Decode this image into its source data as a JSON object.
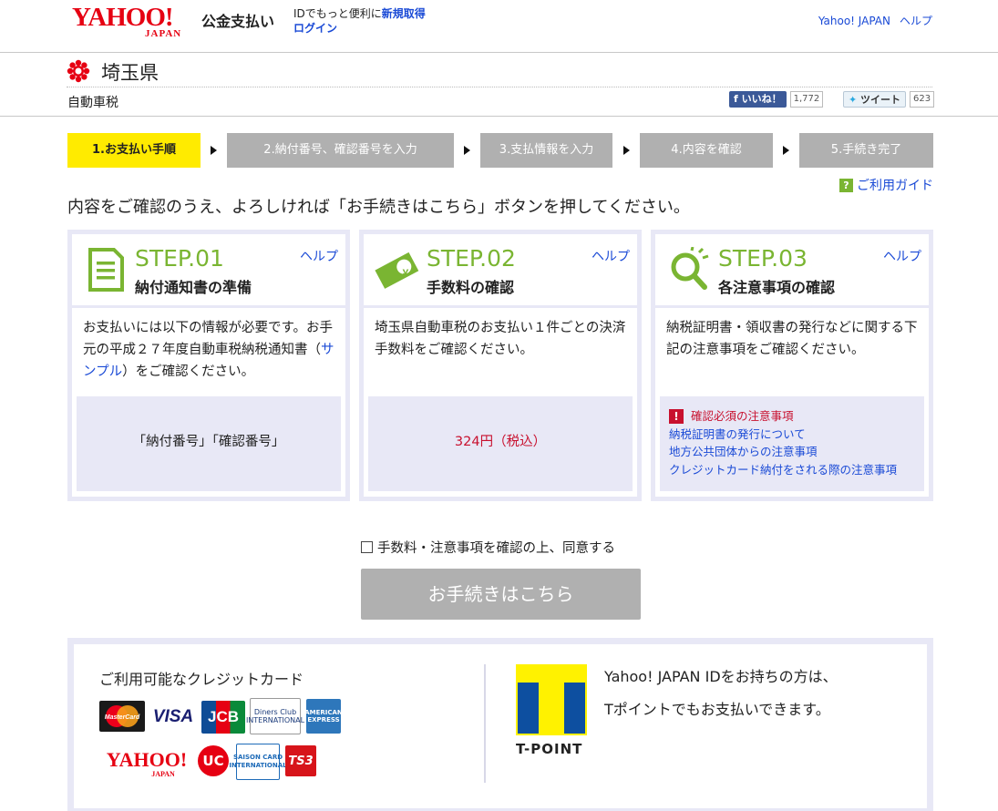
{
  "header": {
    "logo_text": "YAHOO!",
    "logo_sub": "JAPAN",
    "service_name": "公金支払い",
    "id_note": "IDでもっと便利に",
    "register_link": "新規取得",
    "login_link": "ログイン",
    "yahoo_japan_link": "Yahoo! JAPAN",
    "help_link": "ヘルプ"
  },
  "prefecture": {
    "name": "埼玉県",
    "tax_type": "自動車税"
  },
  "social": {
    "like_label": "いいね！",
    "like_count": "1,772",
    "tweet_label": "ツイート",
    "tweet_count": "623"
  },
  "steps": [
    {
      "label": "1.お支払い手順"
    },
    {
      "label": "2.納付番号、確認番号を入力"
    },
    {
      "label": "3.支払情報を入力"
    },
    {
      "label": "4.内容を確認"
    },
    {
      "label": "5.手続き完了"
    }
  ],
  "guide_link": "ご利用ガイド",
  "lead_text": "内容をご確認のうえ、よろしければ「お手続きはこちら」ボタンを押してください。",
  "panels": [
    {
      "step": "STEP.01",
      "title": "納付通知書の準備",
      "help": "ヘルプ",
      "text_before": "お支払いには以下の情報が必要です。お手元の平成２７年度自動車税納税通知書（",
      "sample_link": "サンプル",
      "text_after": "）をご確認ください。",
      "box": "「納付番号」「確認番号」"
    },
    {
      "step": "STEP.02",
      "title": "手数料の確認",
      "help": "ヘルプ",
      "text": "埼玉県自動車税のお支払い１件ごとの決済手数料をご確認ください。",
      "fee": "324円（税込）"
    },
    {
      "step": "STEP.03",
      "title": "各注意事項の確認",
      "help": "ヘルプ",
      "text": "納税証明書・領収書の発行などに関する下記の注意事項をご確認ください。",
      "notes_heading": "確認必須の注意事項",
      "notes": [
        "納税証明書の発行について",
        "地方公共団体からの注意事項",
        "クレジットカード納付をされる際の注意事項"
      ]
    }
  ],
  "agree_label": "手数料・注意事項を確認の上、同意する",
  "proceed_button": "お手続きはこちら",
  "cards": {
    "title": "ご利用可能なクレジットカード",
    "logos": [
      "MasterCard",
      "VISA",
      "JCB",
      "Diners Club INTERNATIONAL",
      "AMERICAN EXPRESS",
      "YAHOO! JAPAN",
      "UC",
      "SAISON CARD INTERNATIONAL",
      "TS3"
    ]
  },
  "tpoint": {
    "logo_text": "T-POINT",
    "line1": "Yahoo! JAPAN IDをお持ちの方は、",
    "line2": "Tポイントでもお支払いできます。"
  },
  "colors": {
    "accent_green": "#7ab532",
    "step_active": "#ffeb00",
    "link_blue": "#1a4ad6",
    "alert_red": "#c8102e"
  }
}
